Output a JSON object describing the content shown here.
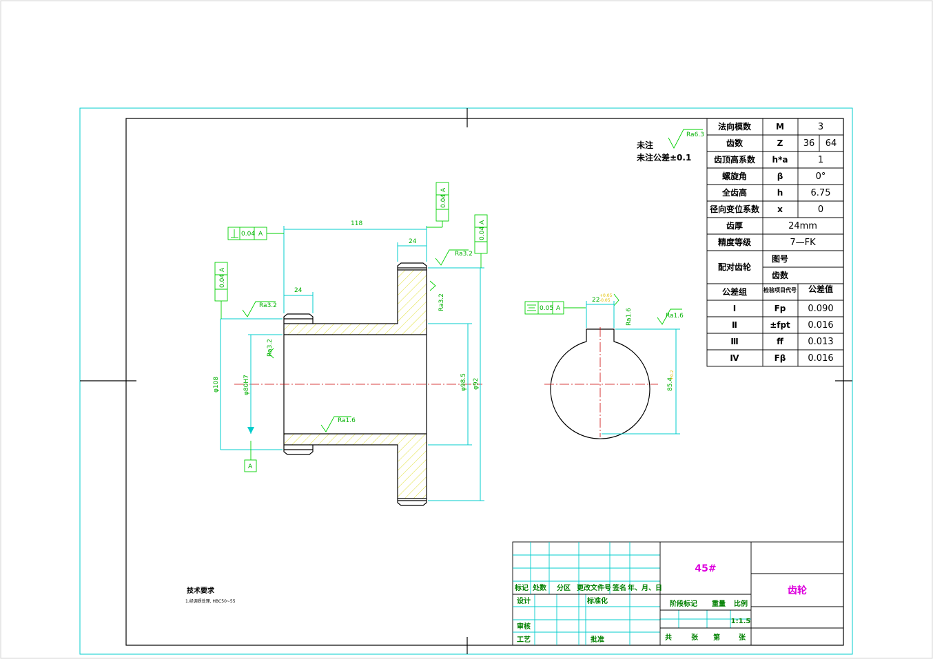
{
  "notes": {
    "unmarked_label": "未注",
    "tolerance": "未注公差±0.1",
    "default_ra": "Ra6.3"
  },
  "params": [
    {
      "name": "法向模数",
      "sym": "M",
      "val": "3"
    },
    {
      "name": "齿数",
      "sym": "Z",
      "val1": "36",
      "val2": "64"
    },
    {
      "name": "齿顶高系数",
      "sym": "h*a",
      "val": "1"
    },
    {
      "name": "螺旋角",
      "sym": "β",
      "val": "0°"
    },
    {
      "name": "全齿高",
      "sym": "h",
      "val": "6.75"
    },
    {
      "name": "径向变位系数",
      "sym": "x",
      "val": "0"
    },
    {
      "name": "齿厚",
      "val": "24mm"
    },
    {
      "name": "精度等级",
      "val": "7—FK"
    }
  ],
  "mating": {
    "label": "配对齿轮",
    "drawing_no": "图号",
    "teeth": "齿数"
  },
  "tolerance_header": {
    "group": "公差组",
    "item": "检验项目代号",
    "value": "公差值"
  },
  "tolerance_groups": [
    {
      "group": "Ⅰ",
      "item": "Fp",
      "value": "0.090"
    },
    {
      "group": "Ⅱ",
      "item": "±fpt",
      "value": "0.016"
    },
    {
      "group": "Ⅲ",
      "item": "ff",
      "value": "0.013"
    },
    {
      "group": "Ⅳ",
      "item": "Fβ",
      "value": "0.016"
    }
  ],
  "dimensions": {
    "length_118": "118",
    "hub_24": "24",
    "rim_24": "24",
    "dia_108": "φ108",
    "dia_bore": "φ80H7",
    "dia_root": "φ98.5",
    "dia_tip": "φ92",
    "key_22": "22",
    "key_22_tol_up": "+0.05",
    "key_22_tol_lo": "-0.05",
    "key_85": "85.4",
    "key_85_tol": "+0.2"
  },
  "roughness": {
    "ra32_a": "Ra3.2",
    "ra32_b": "Ra3.2",
    "ra32_c": "Ra3.2",
    "ra32_d": "Ra3.2",
    "ra16_a": "Ra1.6",
    "ra16_b": "Ra1.6",
    "ra16_c": "Ra1.6"
  },
  "gdt": {
    "perp_1": "0.04",
    "perp_1_ref": "A",
    "run_1": "0.04",
    "run_1_ref": "A",
    "run_2": "0.04",
    "run_2_ref": "A",
    "run_3": "0.04",
    "run_3_ref": "A",
    "sym_1": "0.05",
    "sym_1_ref": "A",
    "datum": "A"
  },
  "tech": {
    "title": "技术要求",
    "line1": "1.经调质处理, HBC50~55"
  },
  "title_block": {
    "material": "45#",
    "part_name": "齿轮",
    "headers": [
      "标记",
      "处数",
      "分区",
      "更改文件号",
      "签名",
      "年、月、日"
    ],
    "design": "设计",
    "standard": "标准化",
    "review": "审核",
    "process": "工艺",
    "approve": "批准",
    "stage": "阶段标记",
    "weight": "重量",
    "scale_label": "比例",
    "scale": "1:1.5",
    "total": "共",
    "sheet_unit": "张",
    "page": "第",
    "page_unit": "张"
  }
}
